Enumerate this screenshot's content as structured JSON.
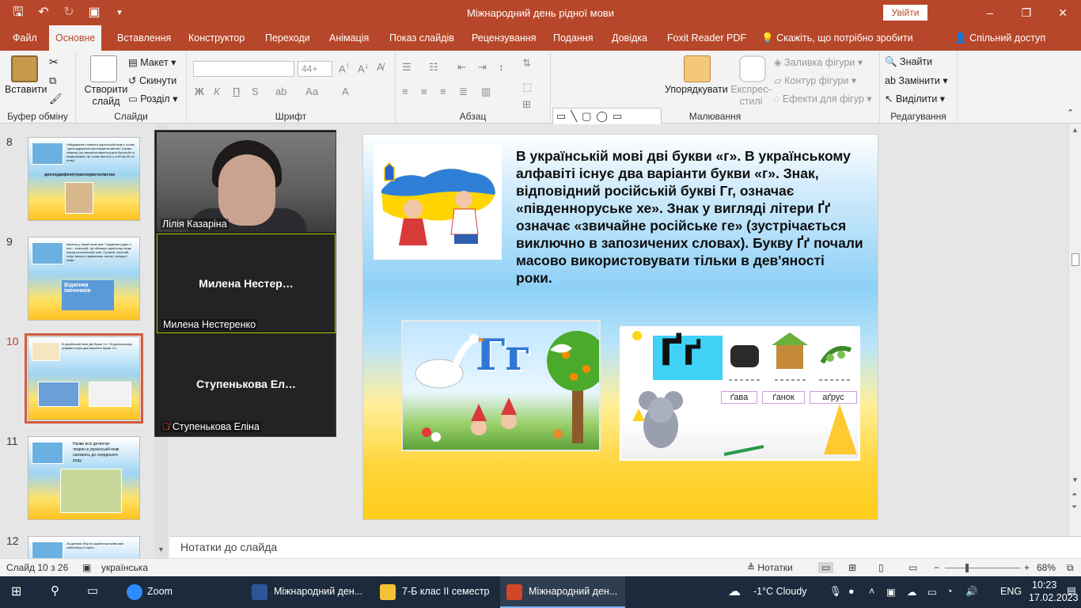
{
  "window": {
    "title": "Міжнародний день рідної мови",
    "signin_label": "Увійти",
    "controls": [
      "–",
      "❐",
      "✕"
    ]
  },
  "tabs": [
    {
      "label": "Файл"
    },
    {
      "label": "Основне"
    },
    {
      "label": "Вставлення"
    },
    {
      "label": "Конструктор"
    },
    {
      "label": "Переходи"
    },
    {
      "label": "Анімація"
    },
    {
      "label": "Показ слайдів"
    },
    {
      "label": "Рецензування"
    },
    {
      "label": "Подання"
    },
    {
      "label": "Довідка"
    },
    {
      "label": "Foxit Reader PDF"
    },
    {
      "label": "Скажіть, що потрібно зробити"
    },
    {
      "label": "Спільний доступ"
    }
  ],
  "ribbon": {
    "clipboard": {
      "paste": "Вставити",
      "group": "Буфер обміну"
    },
    "slides": {
      "new_slide": "Створити слайд",
      "layout": "Макет",
      "reset": "Скинути",
      "section": "Розділ",
      "group": "Слайди"
    },
    "font": {
      "font_size": "44+",
      "bold": "Ж",
      "italic": "К",
      "underline": "П",
      "strike": "S",
      "case": "Аа",
      "group": "Шрифт"
    },
    "paragraph": {
      "group": "Абзац"
    },
    "drawing": {
      "arrange": "Упорядкувати",
      "styles": "Експрес-стилі",
      "fill": "Заливка фігури",
      "outline": "Контур фігури",
      "effects": "Ефекти для фігур",
      "group": "Малювання"
    },
    "editing": {
      "find": "Знайти",
      "replace": "Замінити",
      "select": "Виділити",
      "group": "Редагування"
    }
  },
  "thumbnails": [
    {
      "number": "8",
      "text": "Найдовшим словом в українській мові є слово \"дихлордифенілтрихлорметилметан\" (назва хімікату, що використовується для боротьби зі шкідниками). Це слово містить у собі аж 30-ть літер!",
      "sub": "дихлордифенілтрихлорметилметан"
    },
    {
      "number": "9",
      "text": "Іменник у нашій мові має 7 відмінків (один з них – кличний). Це зближує українську мову серед слов'янських мов. Сьомий, кличний, існує також в граматиках латині, грецької мови.",
      "sub": "Відмінки іменників"
    },
    {
      "number": "10",
      "text": "В українській мові дві букви «г». В українському алфавіті існує два варіанти букви «г».",
      "sub": ""
    },
    {
      "number": "11",
      "text": "Назви всіх дитинчат тварин в українській мові належать до середнього роду.",
      "sub": ""
    },
    {
      "number": "12",
      "text": "За даними Фортіс українська мова має найглибшу історію...",
      "sub": ""
    }
  ],
  "zoom": {
    "participants": [
      {
        "name": "Лілія Казаріна",
        "display": ""
      },
      {
        "name": "Милена Нестеренко",
        "display": "Милена  Нестер…"
      },
      {
        "name": "Ступенькова Еліна",
        "display": "Ступенькова  Ел…"
      }
    ]
  },
  "slide": {
    "text": "В українській мові дві букви «г». В українському алфавіті існує два варіанти букви «г». Знак, відповідний російській букві Гг, означає «південноруське хе». Знак у вигляді літери Ґґ означає «звичайне російське ге» (зустрічається виключно в запозичених словах). Букву Ґґ почали масово використовувати тільки в дев'яності роки.",
    "image_letters": "Гг",
    "image2_letters": "Ґґ",
    "words": [
      "ґава",
      "ґанок",
      "аґрус"
    ]
  },
  "notes_placeholder": "Нотатки до слайда",
  "statusbar": {
    "slide_count": "Слайд 10 з 26",
    "language": "українська",
    "notes": "Нотатки",
    "zoom": "68%"
  },
  "taskbar": {
    "apps": [
      {
        "label": "Zoom"
      },
      {
        "label": "Міжнародний ден..."
      },
      {
        "label": "7-Б клас ІІ семестр"
      },
      {
        "label": "Міжнародний ден..."
      }
    ],
    "weather": "-1°C  Cloudy",
    "language": "ENG",
    "time": "10:23",
    "date": "17.02.2023"
  }
}
